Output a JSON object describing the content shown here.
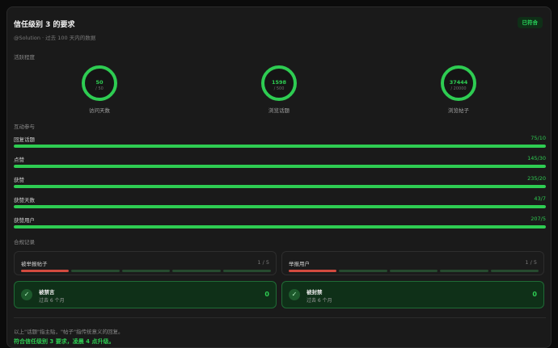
{
  "header": {
    "title": "信任级别 3 的要求",
    "subtitle": "@Solution · 过去 100 天内的数据",
    "status_badge": "已符合"
  },
  "activity": {
    "section_title": "活跃程度",
    "rings": [
      {
        "value": "50",
        "target": "/ 50",
        "label": "访问天数"
      },
      {
        "value": "1598",
        "target": "/ 500",
        "label": "浏览话题"
      },
      {
        "value": "37444",
        "target": "/ 20000",
        "label": "浏览帖子"
      }
    ]
  },
  "engagement": {
    "section_title": "互动参与",
    "items": [
      {
        "label": "回复话题",
        "value": "75/10",
        "progress": 1.0
      },
      {
        "label": "点赞",
        "value": "145/30",
        "progress": 1.0
      },
      {
        "label": "获赞",
        "value": "235/20",
        "progress": 1.0
      },
      {
        "label": "获赞天数",
        "value": "43/7",
        "progress": 1.0
      },
      {
        "label": "获赞用户",
        "value": "207/5",
        "progress": 1.0
      }
    ]
  },
  "compliance": {
    "section_title": "合规记录",
    "flags": [
      {
        "label": "被举报帖子",
        "count": "1 / 5",
        "filled_segments": 1,
        "total_segments": 5
      },
      {
        "label": "举报用户",
        "count": "1 / 5",
        "filled_segments": 1,
        "total_segments": 5
      }
    ],
    "penalties": [
      {
        "title": "被禁言",
        "subtitle": "过去 6 个月",
        "value": "0"
      },
      {
        "title": "被封禁",
        "subtitle": "过去 6 个月",
        "value": "0"
      }
    ]
  },
  "footer": {
    "note": "以上\"话题\"指主贴，\"帖子\"指传统意义的回复。",
    "result": "符合信任级别 3 要求，凌晨 4 点升级。"
  },
  "colors": {
    "accent": "#2ecc52",
    "warning": "#d24a3f",
    "background": "#1a1a1a"
  }
}
